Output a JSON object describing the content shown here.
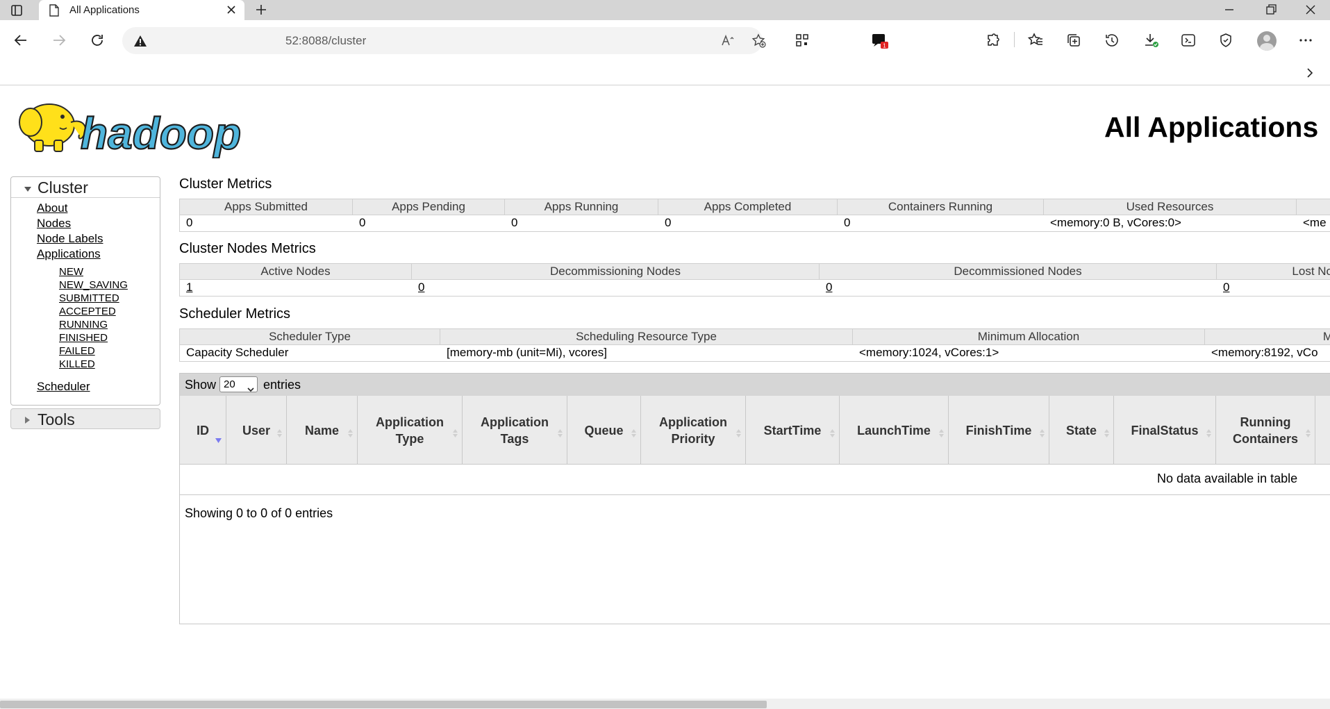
{
  "browser": {
    "tab_title": "All Applications",
    "address": "52:8088/cluster",
    "notification_count": "1"
  },
  "logo_text": "hadoop",
  "page_title": "All Applications",
  "sidebar": {
    "cluster_label": "Cluster",
    "links": [
      "About",
      "Nodes",
      "Node Labels",
      "Applications"
    ],
    "app_states": [
      "NEW",
      "NEW_SAVING",
      "SUBMITTED",
      "ACCEPTED",
      "RUNNING",
      "FINISHED",
      "FAILED",
      "KILLED"
    ],
    "scheduler_link": "Scheduler",
    "tools_label": "Tools"
  },
  "cluster_metrics": {
    "title": "Cluster Metrics",
    "headers": [
      "Apps Submitted",
      "Apps Pending",
      "Apps Running",
      "Apps Completed",
      "Containers Running",
      "Used Resources",
      ""
    ],
    "values": [
      "0",
      "0",
      "0",
      "0",
      "0",
      "<memory:0 B, vCores:0>",
      "<me"
    ]
  },
  "nodes_metrics": {
    "title": "Cluster Nodes Metrics",
    "headers": [
      "Active Nodes",
      "Decommissioning Nodes",
      "Decommissioned Nodes",
      "Lost No"
    ],
    "values": [
      "1",
      "0",
      "0",
      "0"
    ]
  },
  "scheduler_metrics": {
    "title": "Scheduler Metrics",
    "headers": [
      "Scheduler Type",
      "Scheduling Resource Type",
      "Minimum Allocation",
      "M"
    ],
    "values": [
      "Capacity Scheduler",
      "[memory-mb (unit=Mi), vcores]",
      "<memory:1024, vCores:1>",
      "<memory:8192, vCo"
    ]
  },
  "apps_table": {
    "show_label": "Show",
    "page_size": "20",
    "entries_label": "entries",
    "columns": [
      "ID",
      "User",
      "Name",
      "Application Type",
      "Application Tags",
      "Queue",
      "Application Priority",
      "StartTime",
      "LaunchTime",
      "FinishTime",
      "State",
      "FinalStatus",
      "Running Containers"
    ],
    "empty_message": "No data available in table",
    "info": "Showing 0 to 0 of 0 entries"
  },
  "colors": {
    "logo_yellow": "#ffe01a",
    "logo_blue": "#4fb5dc",
    "sort_active": "#7b7bf0",
    "badge_red": "#e02424"
  },
  "icons": [
    "sidebar-toggle-icon",
    "page-icon",
    "close-icon",
    "plus-icon",
    "minimize-icon",
    "restore-icon",
    "back-icon",
    "forward-icon",
    "refresh-icon",
    "warning-icon",
    "read-aloud-icon",
    "add-favorite-icon",
    "qr-icon",
    "extension-icon",
    "favorites-icon",
    "collections-icon",
    "history-icon",
    "download-icon",
    "screenshot-icon",
    "performance-icon",
    "more-icon",
    "chevron-right-icon"
  ]
}
